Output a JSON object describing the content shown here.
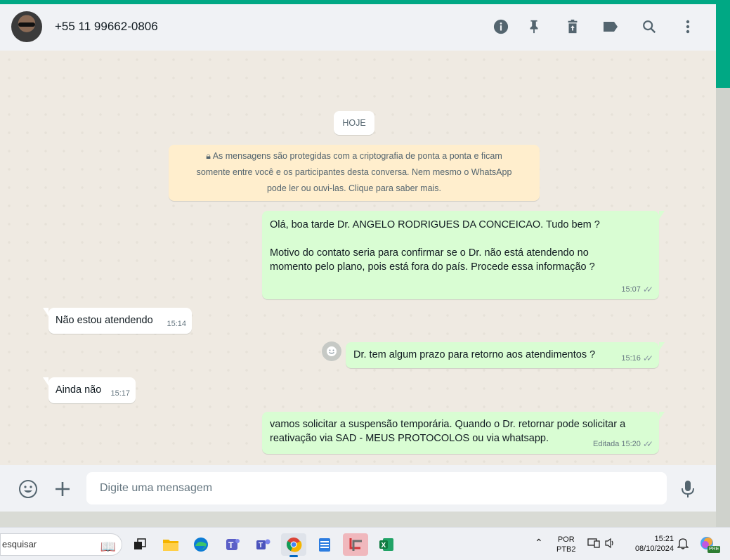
{
  "header": {
    "contact_name": "+55 11 99662-0806",
    "icons": [
      "info-icon",
      "pin-icon",
      "delete-icon",
      "label-icon",
      "search-icon",
      "menu-icon"
    ]
  },
  "chat": {
    "day_label": "HOJE",
    "encryption_notice": "As mensagens são protegidas com a criptografia de ponta a ponta e ficam somente entre você e os participantes desta conversa. Nem mesmo o WhatsApp pode ler ou ouvi-las. Clique para saber mais.",
    "encryption_lines": [
      "As mensagens são protegidas com a criptografia de ponta a ponta e ficam",
      "somente entre você e os participantes desta conversa. Nem mesmo o WhatsApp",
      "pode ler ou ouvi-las. Clique para saber mais."
    ],
    "messages": [
      {
        "direction": "out",
        "lines": [
          "Olá, boa tarde Dr. ANGELO RODRIGUES DA CONCEICAO. Tudo bem ?",
          "",
          "Motivo do contato seria para confirmar se o Dr. não está atendendo no",
          "momento pelo plano, pois está fora do país. Procede essa informação ?"
        ],
        "time": "15:07",
        "edited": ""
      },
      {
        "direction": "in",
        "lines": [
          "Não estou atendendo"
        ],
        "time": "15:14",
        "edited": ""
      },
      {
        "direction": "out",
        "lines": [
          "Dr. tem algum prazo para retorno aos atendimentos ?"
        ],
        "time": "15:16",
        "edited": ""
      },
      {
        "direction": "in",
        "lines": [
          "Ainda não"
        ],
        "time": "15:17",
        "edited": ""
      },
      {
        "direction": "out",
        "lines": [
          "vamos solicitar a suspensão temporária. Quando o Dr. retornar pode solicitar a",
          "reativação via SAD - MEUS PROTOCOLOS ou via whatsapp."
        ],
        "time": "15:20",
        "edited": "Editada"
      }
    ]
  },
  "footer": {
    "placeholder": "Digite uma mensagem"
  },
  "taskbar": {
    "search_text": "esquisar",
    "lang_top": "POR",
    "lang_bottom": "PTB2",
    "time": "15:21",
    "date": "08/10/2024",
    "pre_badge": "PRE"
  },
  "colors": {
    "accent": "#00a884",
    "outgoing_bubble": "#d9fdd3",
    "incoming_bubble": "#ffffff",
    "encryption_bg": "#ffeecd",
    "chat_bg": "#efeae2"
  }
}
